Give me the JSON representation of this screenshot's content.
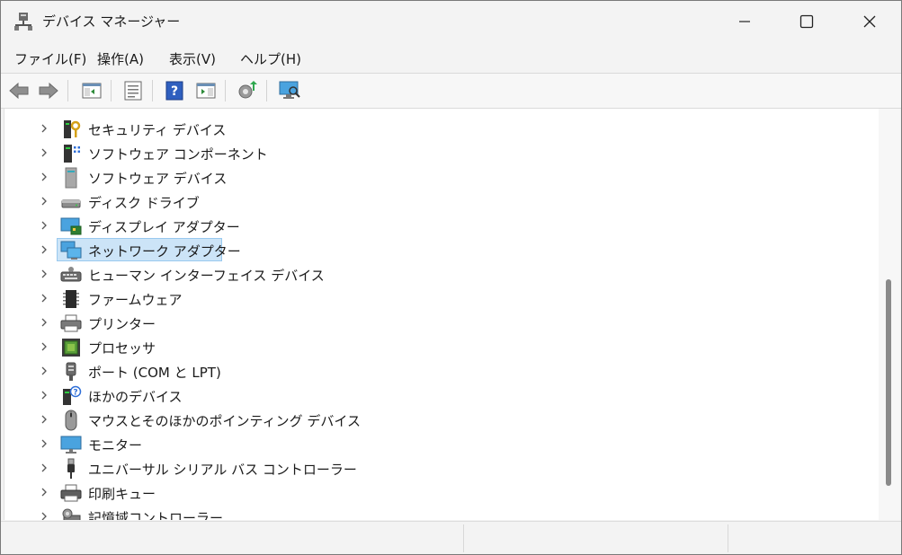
{
  "window": {
    "title": "デバイス マネージャー",
    "app_icon": "device-manager-icon",
    "controls": [
      "minimize-icon",
      "maximize-icon",
      "close-icon"
    ]
  },
  "menu": [
    {
      "label": "ファイル(F)"
    },
    {
      "label": "操作(A)"
    },
    {
      "label": "表示(V)"
    },
    {
      "label": "ヘルプ(H)"
    }
  ],
  "toolbar": [
    {
      "icon": "back-arrow-icon"
    },
    {
      "icon": "forward-arrow-icon"
    },
    {
      "icon": "show-hide-console-tree-icon"
    },
    {
      "icon": "properties-icon"
    },
    {
      "icon": "help-icon"
    },
    {
      "icon": "show-action-pane-icon"
    },
    {
      "icon": "update-driver-icon"
    },
    {
      "icon": "scan-hardware-changes-icon"
    }
  ],
  "tree": {
    "items": [
      {
        "label": "セキュリティ デバイス",
        "icon": "security-device-icon"
      },
      {
        "label": "ソフトウェア コンポーネント",
        "icon": "software-component-icon"
      },
      {
        "label": "ソフトウェア デバイス",
        "icon": "software-device-icon"
      },
      {
        "label": "ディスク ドライブ",
        "icon": "disk-drive-icon"
      },
      {
        "label": "ディスプレイ アダプター",
        "icon": "display-adapter-icon"
      },
      {
        "label": "ネットワーク アダプター",
        "icon": "network-adapter-icon",
        "selected": true
      },
      {
        "label": "ヒューマン インターフェイス デバイス",
        "icon": "hid-icon"
      },
      {
        "label": "ファームウェア",
        "icon": "firmware-icon"
      },
      {
        "label": "プリンター",
        "icon": "printer-icon"
      },
      {
        "label": "プロセッサ",
        "icon": "processor-icon"
      },
      {
        "label": "ポート (COM と LPT)",
        "icon": "port-icon"
      },
      {
        "label": "ほかのデバイス",
        "icon": "other-devices-icon"
      },
      {
        "label": "マウスとそのほかのポインティング デバイス",
        "icon": "mouse-icon"
      },
      {
        "label": "モニター",
        "icon": "monitor-icon"
      },
      {
        "label": "ユニバーサル シリアル バス コントローラー",
        "icon": "usb-icon"
      },
      {
        "label": "印刷キュー",
        "icon": "print-queue-icon"
      },
      {
        "label": "記憶域コントローラー",
        "icon": "storage-controller-icon"
      }
    ]
  },
  "colors": {
    "selection_fill": "#cce4f7",
    "selection_border": "#99c9ef"
  }
}
